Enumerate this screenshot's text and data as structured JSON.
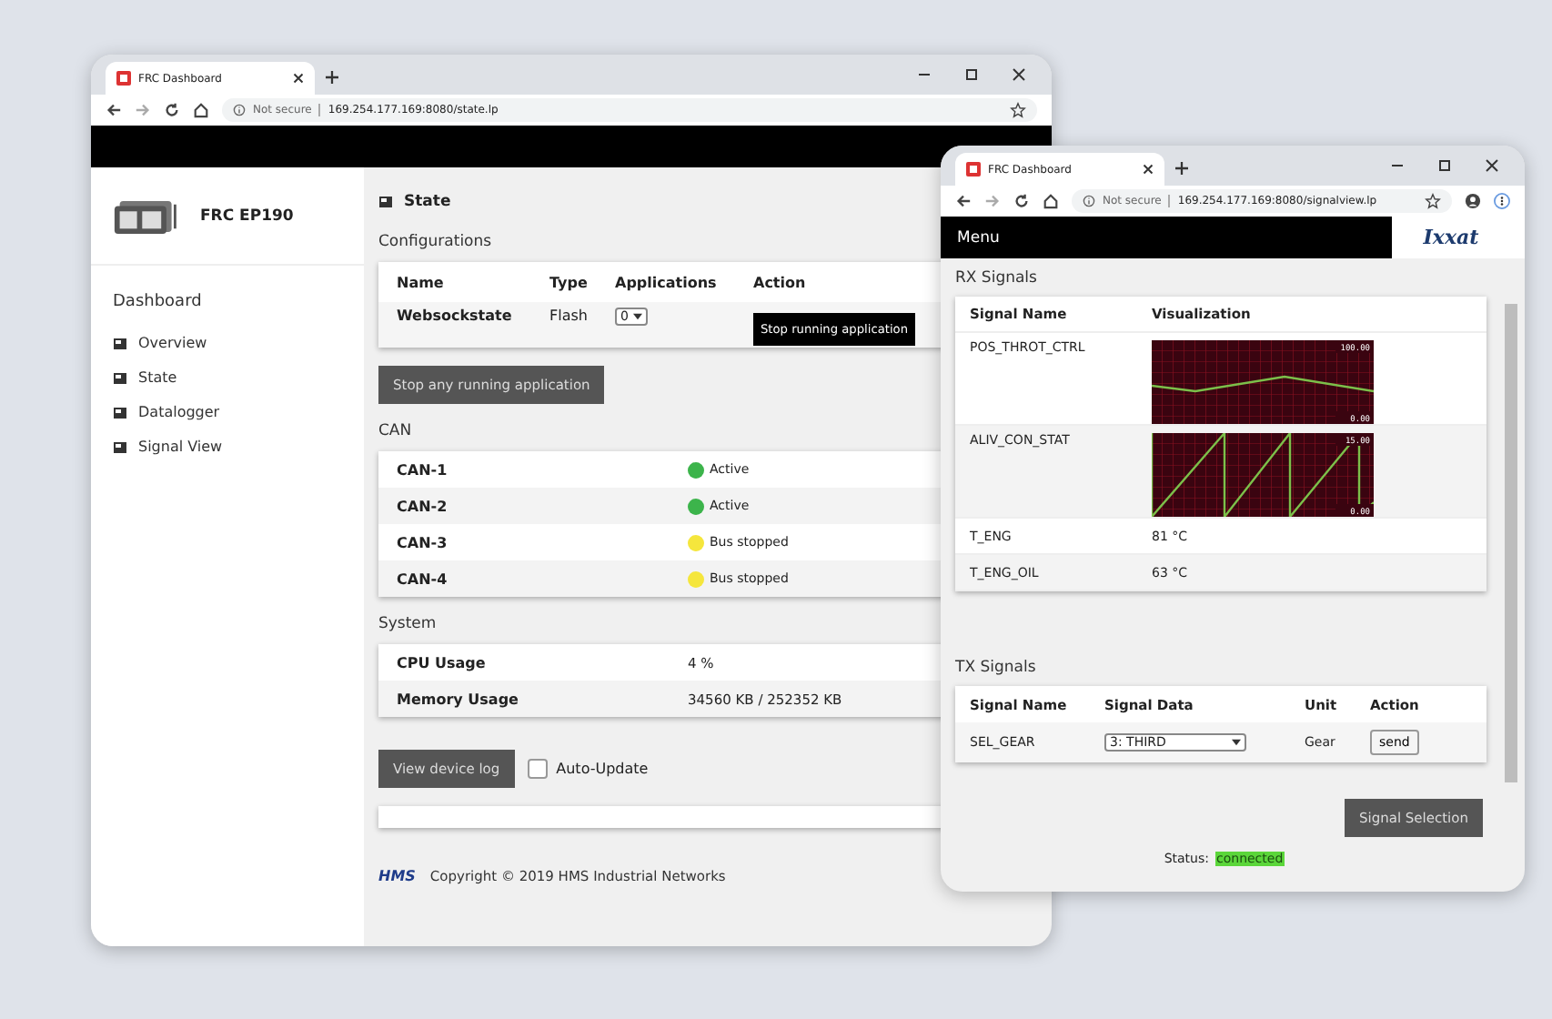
{
  "state_window": {
    "tab_title": "FRC Dashboard",
    "security": "Not secure",
    "url": "169.254.177.169:8080/state.lp",
    "device_name": "FRC EP190",
    "sidebar": {
      "heading": "Dashboard",
      "items": [
        {
          "label": "Overview"
        },
        {
          "label": "State"
        },
        {
          "label": "Datalogger"
        },
        {
          "label": "Signal View"
        }
      ]
    },
    "page_title": "State",
    "configurations": {
      "heading": "Configurations",
      "columns": [
        "Name",
        "Type",
        "Applications",
        "Action"
      ],
      "rows": [
        {
          "name": "Websockstate",
          "type": "Flash",
          "applications": "0",
          "action": "Stop running application"
        }
      ]
    },
    "stop_all_button": "Stop any running application",
    "can": {
      "heading": "CAN",
      "rows": [
        {
          "name": "CAN-1",
          "status": "Active",
          "color": "#3cb44b"
        },
        {
          "name": "CAN-2",
          "status": "Active",
          "color": "#3cb44b"
        },
        {
          "name": "CAN-3",
          "status": "Bus stopped",
          "color": "#f5e63c"
        },
        {
          "name": "CAN-4",
          "status": "Bus stopped",
          "color": "#f5e63c"
        }
      ]
    },
    "system": {
      "heading": "System",
      "rows": [
        {
          "label": "CPU Usage",
          "value": "4 %"
        },
        {
          "label": "Memory Usage",
          "value": "34560 KB / 252352 KB"
        }
      ]
    },
    "log_button": "View device log",
    "auto_update": {
      "label": "Auto-Update",
      "checked": false
    },
    "footer": {
      "logo": "HMS",
      "copyright": "Copyright © 2019 HMS Industrial Networks"
    }
  },
  "signal_window": {
    "tab_title": "FRC Dashboard",
    "security": "Not secure",
    "url": "169.254.177.169:8080/signalview.lp",
    "menu": "Menu",
    "logo": "Ixxat",
    "rx": {
      "heading": "RX Signals",
      "columns": [
        "Signal Name",
        "Visualization"
      ],
      "rows": [
        {
          "kind": "triangle",
          "name": "POS_THROT_CTRL",
          "scale_max": "100.00",
          "scale_min": "0.00"
        },
        {
          "kind": "sawtooth",
          "name": "ALIV_CON_STAT",
          "scale_max": "15.00",
          "scale_min": "0.00"
        },
        {
          "kind": "value",
          "name": "T_ENG",
          "value": "81 °C"
        },
        {
          "kind": "value",
          "name": "T_ENG_OIL",
          "value": "63 °C"
        }
      ]
    },
    "tx": {
      "heading": "TX Signals",
      "columns": [
        "Signal Name",
        "Signal Data",
        "Unit",
        "Action"
      ],
      "rows": [
        {
          "name": "SEL_GEAR",
          "data": "3: THIRD",
          "unit": "Gear",
          "action": "send"
        }
      ]
    },
    "selection_button": "Signal Selection",
    "status": {
      "label": "Status:",
      "value": "connected"
    }
  }
}
